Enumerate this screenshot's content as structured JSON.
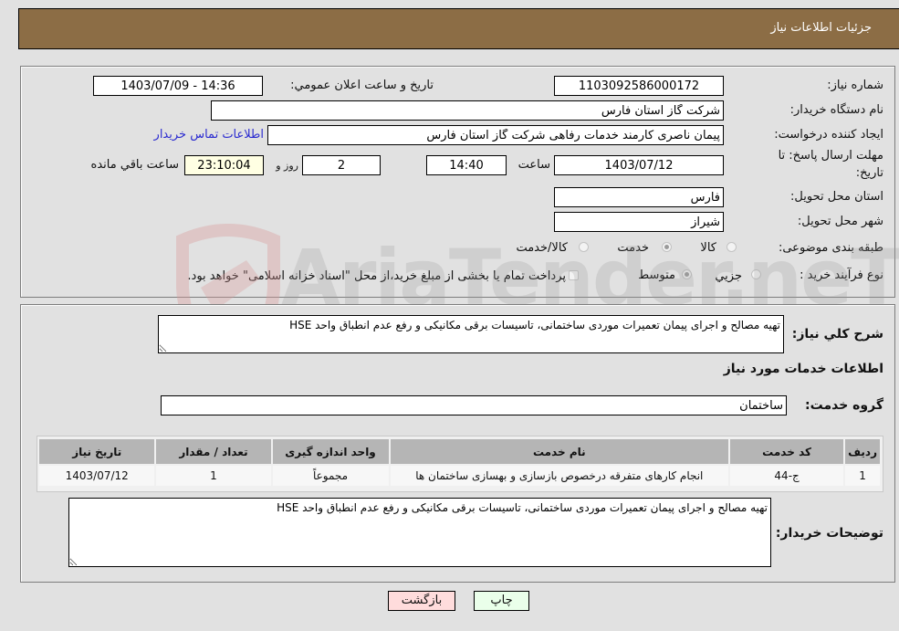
{
  "header": {
    "title": "جزئیات اطلاعات نیاز"
  },
  "fields": {
    "need_number": {
      "label": "شماره نیاز:",
      "value": "1103092586000172"
    },
    "announce_datetime": {
      "label": "تاریخ و ساعت اعلان عمومي:",
      "value": "1403/07/09 - 14:36"
    },
    "buyer_org": {
      "label": "نام دستگاه خریدار:",
      "value": "شرکت گاز استان فارس"
    },
    "requester": {
      "label": "ایجاد کننده درخواست:",
      "value": "پیمان ناصری کارمند خدمات رفاهی شرکت گاز استان فارس"
    },
    "buyer_contact_link": "اطلاعات تماس خریدار",
    "deadline": {
      "label_line1": "مهلت ارسال پاسخ: تا",
      "label_line2": "تاریخ:",
      "date": "1403/07/12",
      "time_label": "ساعت",
      "time": "14:40",
      "days": "2",
      "days_label": "روز و",
      "remaining": "23:10:04",
      "remaining_label": "ساعت باقي مانده"
    },
    "province": {
      "label": "استان محل تحویل:",
      "value": "فارس"
    },
    "city": {
      "label": "شهر محل تحویل:",
      "value": "شیراز"
    },
    "category": {
      "label": "طبقه بندی موضوعی:",
      "options": [
        {
          "label": "کالا",
          "selected": false
        },
        {
          "label": "خدمت",
          "selected": true
        },
        {
          "label": "کالا/خدمت",
          "selected": false
        }
      ]
    },
    "process_type": {
      "label": "نوع فرآیند خرید :",
      "options": [
        {
          "label": "جزيي",
          "selected": false
        },
        {
          "label": "متوسط",
          "selected": true
        }
      ],
      "treasury_checkbox": {
        "label": "پرداخت تمام یا بخشی از مبلغ خرید،از محل \"اسناد خزانه اسلامی\" خواهد بود.",
        "checked": false
      }
    }
  },
  "description": {
    "label": "شرح کلي نیاز:",
    "value": "تهیه مصالح و اجرای پیمان تعمیرات موردی ساختمانی، تاسیسات برقی مکانیکی و رفع عدم انطباق واحد HSE"
  },
  "services": {
    "title": "اطلاعات خدمات مورد نیاز",
    "group_label": "گروه خدمت:",
    "group_value": "ساختمان",
    "table": {
      "headers": [
        "ردیف",
        "کد خدمت",
        "نام خدمت",
        "واحد اندازه گیری",
        "تعداد / مقدار",
        "تاریخ نیاز"
      ],
      "rows": [
        [
          "1",
          "ج-44",
          "انجام کارهای متفرقه درخصوص بازسازی و بهسازی ساختمان ها",
          "مجموعاً",
          "1",
          "1403/07/12"
        ]
      ]
    }
  },
  "buyer_notes": {
    "label": "توضیحات خریدار:",
    "value": "تهیه مصالح و اجرای پیمان تعمیرات موردی ساختمانی، تاسیسات برقی مکانیکی و رفع عدم انطباق واحد HSE"
  },
  "buttons": {
    "print": "چاپ",
    "back": "بازگشت"
  },
  "colors": {
    "header_bg": "#8c6d45",
    "page_bg": "#e1e1e1",
    "link": "#2b2bd0",
    "remaining_bg": "#ffffe3",
    "back_button_bg": "#ffdcdc",
    "print_button_bg": "#eaffea",
    "table_header_bg": "#b5b5b5"
  },
  "watermark": {
    "text": "AriaTender.neT"
  }
}
